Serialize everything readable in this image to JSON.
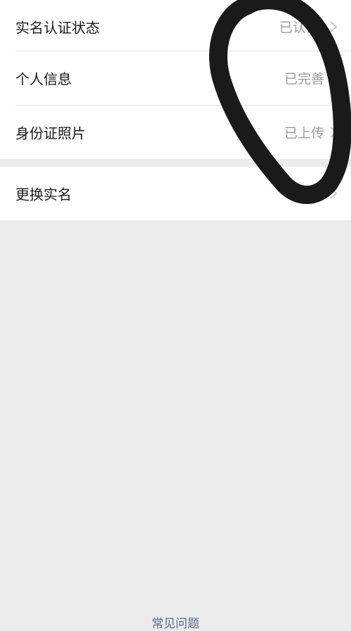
{
  "rows": [
    {
      "label": "实名认证状态",
      "value": "已认证("
    },
    {
      "label": "个人信息",
      "value": "已完善"
    },
    {
      "label": "身份证照片",
      "value": "已上传"
    }
  ],
  "change_row": {
    "label": "更换实名"
  },
  "footer": {
    "link_label": "常见问题"
  },
  "icons": {
    "row_chevron": "chevron-right-icon"
  },
  "colors": {
    "background": "#ebebeb",
    "card": "#ffffff",
    "label_text": "#1a1a1a",
    "value_text": "#9a9a9a",
    "link_text": "#5a6b8c",
    "scribble": "#1a1a1a"
  }
}
